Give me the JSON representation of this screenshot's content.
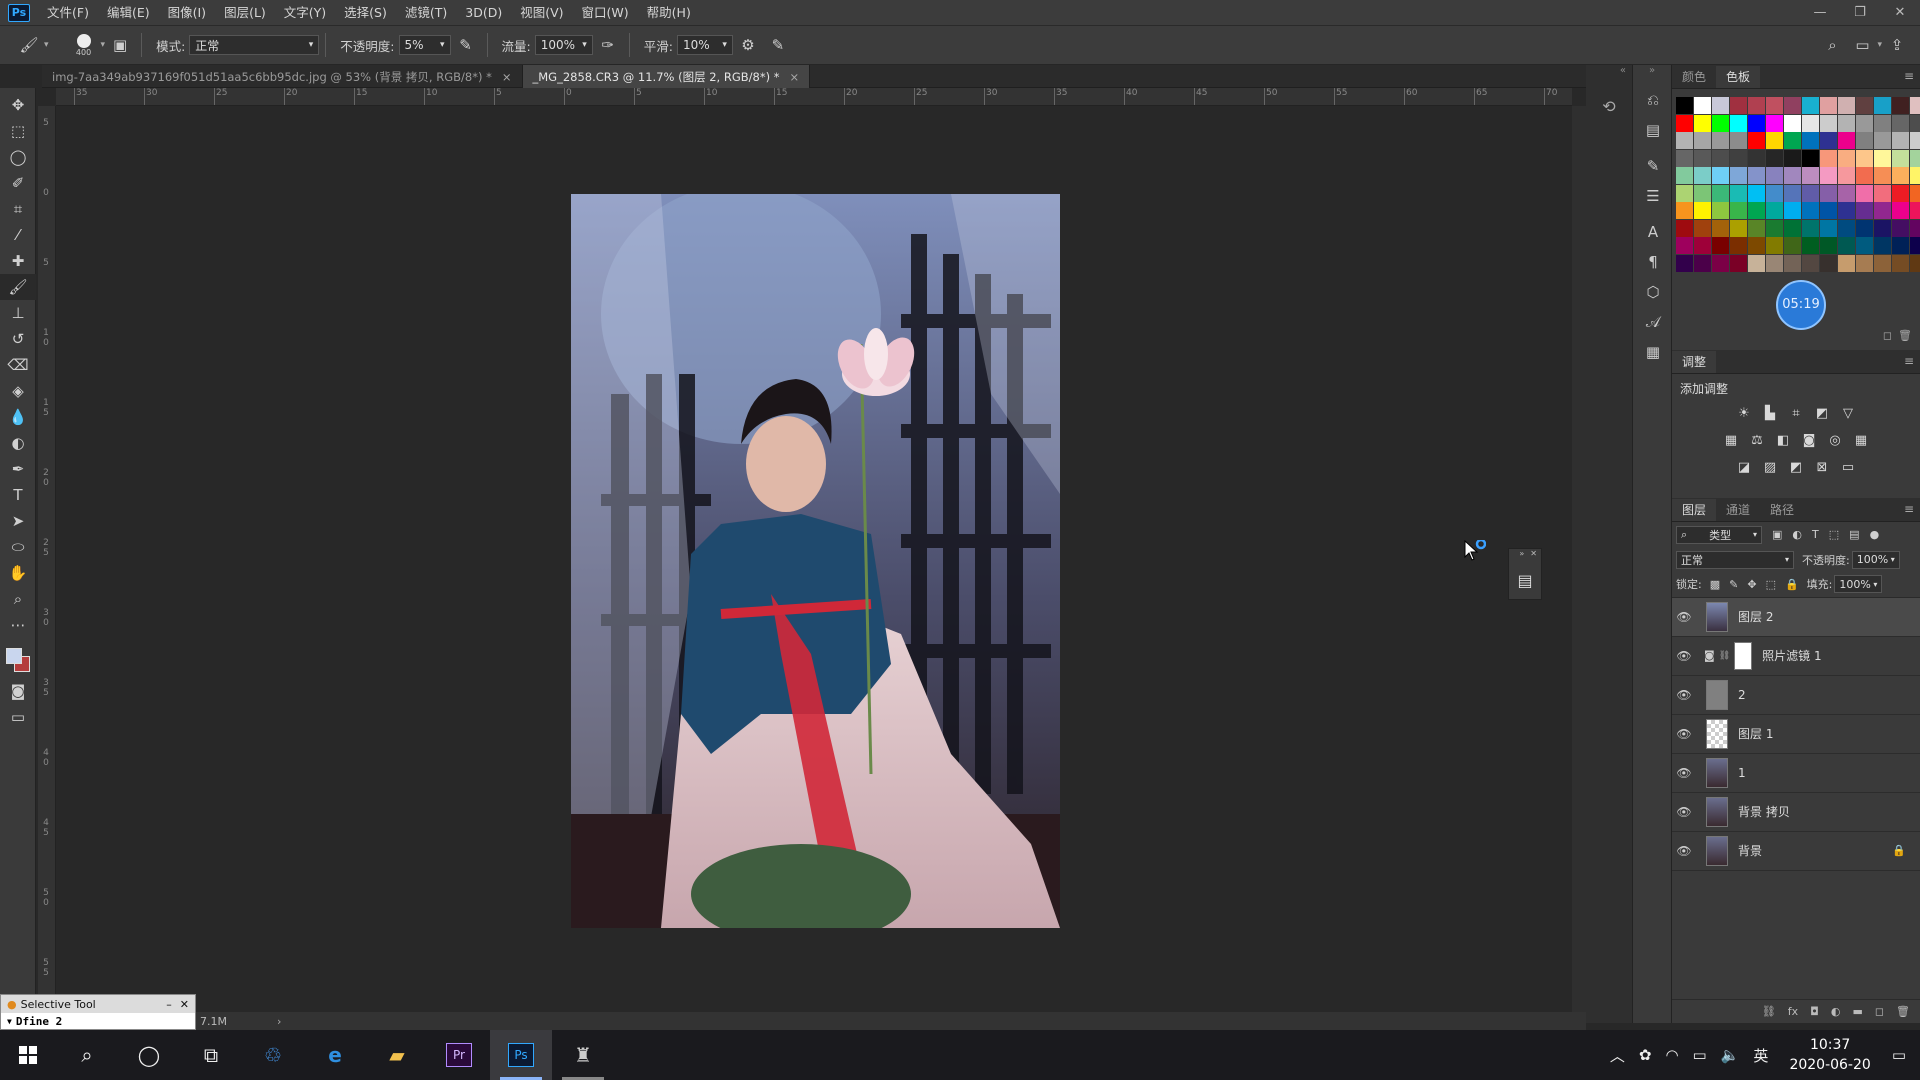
{
  "menubar": {
    "logo": "Ps",
    "items": [
      "文件(F)",
      "编辑(E)",
      "图像(I)",
      "图层(L)",
      "文字(Y)",
      "选择(S)",
      "滤镜(T)",
      "3D(D)",
      "视图(V)",
      "窗口(W)",
      "帮助(H)"
    ]
  },
  "options": {
    "brush_size": "400",
    "mode_label": "模式:",
    "mode_value": "正常",
    "opacity_label": "不透明度:",
    "opacity_value": "5%",
    "flow_label": "流量:",
    "flow_value": "100%",
    "smoothing_label": "平滑:",
    "smoothing_value": "10%"
  },
  "tabs": [
    {
      "label": "img-7aa349ab937169f051d51aa5c6bb95dc.jpg @ 53% (背景 拷贝, RGB/8*) *",
      "close": "×"
    },
    {
      "label": "_MG_2858.CR3 @ 11.7% (图层 2, RGB/8*) *",
      "close": "×"
    }
  ],
  "ruler_top": [
    "35",
    "30",
    "25",
    "20",
    "15",
    "10",
    "5",
    "0",
    "5",
    "10",
    "15",
    "20",
    "25",
    "30",
    "35",
    "40",
    "45",
    "50",
    "55",
    "60",
    "65",
    "70"
  ],
  "ruler_left": [
    "5",
    "0",
    "5",
    "1 0",
    "1 5",
    "2 0",
    "2 5",
    "3 0",
    "3 5",
    "4 0",
    "4 5",
    "5 0",
    "5 5"
  ],
  "statusbar": {
    "size": "7.1M"
  },
  "swatches_panel": {
    "tabs": [
      "颜色",
      "色板"
    ],
    "timer": "05:19",
    "colors": [
      "#000000",
      "#ffffff",
      "#c8c8d8",
      "#a03040",
      "#b04050",
      "#c05060",
      "#904060",
      "#18b0d0",
      "#e0a0a0",
      "#d0b0b0",
      "#604040",
      "#18a0c8",
      "#402020",
      "#e0c0c0",
      "#ff0000",
      "#ffff00",
      "#00ff00",
      "#00ffff",
      "#0000ff",
      "#ff00ff",
      "#ffffff",
      "#e6e6e6",
      "#cccccc",
      "#b3b3b3",
      "#999999",
      "#808080",
      "#666666",
      "#4d4d4d",
      "#b3b3b3",
      "#a6a6a6",
      "#999999",
      "#8c8c8c",
      "#ff0000",
      "#ffd700",
      "#00a651",
      "#0072bc",
      "#2e3192",
      "#ec008c",
      "#808080",
      "#999999",
      "#b3b3b3",
      "#cccccc",
      "#666666",
      "#595959",
      "#4d4d4d",
      "#404040",
      "#333333",
      "#262626",
      "#1a1a1a",
      "#000000",
      "#f7977a",
      "#f9ad81",
      "#fdc68a",
      "#fff79a",
      "#c4df9b",
      "#a3d39c",
      "#82ca9d",
      "#7bcdc8",
      "#6ecff6",
      "#7ea7d8",
      "#8493ca",
      "#8882be",
      "#a187be",
      "#bc8dbf",
      "#f49ac2",
      "#f6989d",
      "#f26c4f",
      "#f68e55",
      "#fbaf5c",
      "#fff467",
      "#acd372",
      "#7cc576",
      "#3bb878",
      "#1abbb4",
      "#00bff3",
      "#438ccb",
      "#5574b9",
      "#605ca8",
      "#855fa8",
      "#a763a8",
      "#f06ea9",
      "#f26d7d",
      "#ed1c24",
      "#f26522",
      "#f7941d",
      "#fff200",
      "#8dc73f",
      "#39b54a",
      "#00a651",
      "#00a99d",
      "#00aeef",
      "#0072bc",
      "#0054a6",
      "#2e3192",
      "#662d91",
      "#92278f",
      "#ec008c",
      "#ed145b",
      "#9e0b0f",
      "#a0410d",
      "#a3620a",
      "#aba000",
      "#598527",
      "#1a7b30",
      "#007236",
      "#00746b",
      "#0076a3",
      "#004b80",
      "#003471",
      "#1b1464",
      "#440e62",
      "#630460",
      "#9e005d",
      "#9e0039",
      "#790000",
      "#7b2e00",
      "#7d4900",
      "#827b00",
      "#406618",
      "#005e20",
      "#005826",
      "#005952",
      "#005b7f",
      "#003663",
      "#002157",
      "#0d004c",
      "#32004b",
      "#4b0049",
      "#7b0046",
      "#7a0026",
      "#c7b299",
      "#998675",
      "#736357",
      "#534741",
      "#37302d",
      "#c69c6d",
      "#a67c52",
      "#8c6239",
      "#754c24",
      "#603913"
    ]
  },
  "adjustments": {
    "title": "调整",
    "subtitle": "添加调整"
  },
  "layers_panel": {
    "tabs": [
      "图层",
      "通道",
      "路径"
    ],
    "filter": "类型",
    "blend_mode": "正常",
    "opacity_label": "不透明度:",
    "opacity_value": "100%",
    "lock_label": "锁定:",
    "fill_label": "填充:",
    "fill_value": "100%",
    "layers": [
      {
        "name": "图层 2",
        "active": true,
        "thumb": "photo"
      },
      {
        "name": "照片滤镜 1",
        "active": false,
        "thumb": "adjust"
      },
      {
        "name": "2",
        "active": false,
        "thumb": "gray"
      },
      {
        "name": "图层 1",
        "active": false,
        "thumb": "transparent"
      },
      {
        "name": "1",
        "active": false,
        "thumb": "photo"
      },
      {
        "name": "背景 拷贝",
        "active": false,
        "thumb": "photo"
      },
      {
        "name": "背景",
        "active": false,
        "thumb": "photo",
        "locked": true
      }
    ]
  },
  "selective_tool": {
    "title": "Selective Tool",
    "item": "Dfine 2"
  },
  "taskbar": {
    "time": "10:37",
    "date": "2020-06-20",
    "ime": "英"
  }
}
